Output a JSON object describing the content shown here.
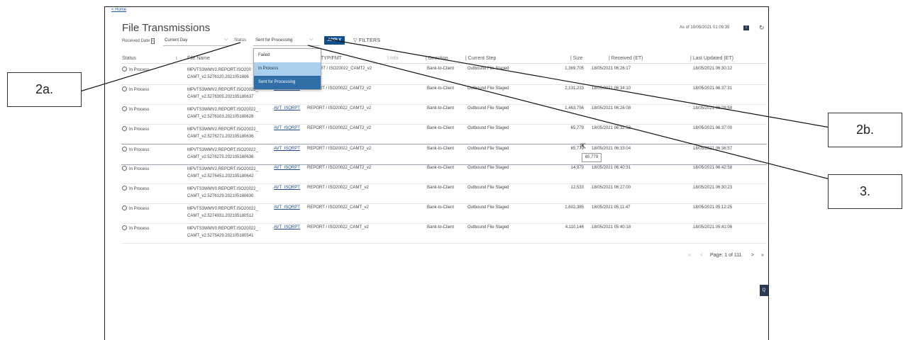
{
  "nav": {
    "home_link": "< Home"
  },
  "page": {
    "title": "File Transmissions",
    "as_of": "As of 19/05/2021 01:09:35",
    "info_icon_glyph": "i",
    "refresh_icon": "refresh-icon"
  },
  "filters": {
    "received_date_label": "Received Date",
    "received_date_info": "i",
    "received_date_value": "Current Day",
    "status_label": "Status",
    "status_value": "Sent for Processing",
    "apply_label": "APPLY",
    "filters_label": "FILTERS",
    "status_options": [
      "Failed",
      "In Process",
      "Sent for Processing"
    ]
  },
  "table": {
    "columns": [
      "Status",
      "File Name",
      "TYP/FMT",
      "Direction",
      "Current Step",
      "Size",
      "Received (ET)",
      "Last Updated (ET)"
    ],
    "hidden_column_partial": "Info",
    "rows": [
      {
        "status": "In Process",
        "file1": "MPVTS3WMV2.REPORT.ISO200",
        "file2": "CAMT_v2.5276120.2021051806",
        "link": "",
        "typ": "RT / ISO20022_CAMT2_v2",
        "direction": "Bank-to-Client",
        "step": "Outbound File Staged",
        "size": "1,369,705",
        "received": "18/05/2021 06:26:17",
        "updated": "18/05/2021 06:30:12"
      },
      {
        "status": "In Process",
        "file1": "MPVTS3WMV2.REPORT.ISO20022_",
        "file2": "CAMT_v2.5276305.202105180637",
        "link": "AVT_ISQRPT",
        "typ": "REPORT / ISO20022_CAMT2_v2",
        "direction": "Bank-to-Client",
        "step": "Outbound File Staged",
        "size": "2,131,233",
        "received": "18/05/2021 06:34:10",
        "updated": "18/05/2021 06:37:31"
      },
      {
        "status": "In Process",
        "file1": "MPVTS3WMV2.REPORT.ISO20022_",
        "file2": "CAMT_v2.5276103.202105180628",
        "link": "AVT_ISQRPT",
        "typ": "REPORT / ISO20022_CAMT2_v2",
        "direction": "Bank-to-Client",
        "step": "Outbound File Staged",
        "size": "1,463,756",
        "received": "18/05/2021 06:26:08",
        "updated": "18/05/2021 06:28:59"
      },
      {
        "status": "In Process",
        "file1": "MPVTS3WMV2.REPORT.ISO20022_",
        "file2": "CAMT_v2.5276271.202105180636",
        "link": "AVT_ISQRPT",
        "typ": "REPORT / ISO20022_CAMT2_v2",
        "direction": "Bank-to-Client",
        "step": "Outbound File Staged",
        "size": "65,779",
        "received": "18/05/2021 06:32:53",
        "updated": "18/05/2021 06:37:00"
      },
      {
        "status": "In Process",
        "file1": "MPVTS3WMV2.REPORT.ISO20022_",
        "file2": "CAMT_v2.5276275.202105180636",
        "link": "AVT_ISQRPT",
        "typ": "REPORT / ISO20022_CAMT2_v2",
        "direction": "Bank-to-Client",
        "step": "Outbound File Staged",
        "size": "65,779",
        "received": "18/05/2021 06:33:04",
        "updated": "18/05/2021 06:36:57"
      },
      {
        "status": "In Process",
        "file1": "MPVTS3WMV2.REPORT.ISO20022_",
        "file2": "CAMT_v2.5276451.202105180642",
        "link": "AVT_ISQRPT",
        "typ": "REPORT / ISO20022_CAMT2_v2",
        "direction": "Bank-to-Client",
        "step": "Outbound File Staged",
        "size": "14,979",
        "received": "18/05/2021 06:40:31",
        "updated": "18/05/2021 06:42:58"
      },
      {
        "status": "In Process",
        "file1": "MPVTS3WMV0.REPORT.ISO20022_",
        "file2": "CAMT_v2.5276129.202105180630",
        "link": "AVT_ISQRPT",
        "typ": "REPORT / ISO20022_CAMT_v2",
        "direction": "Bank-to-Client",
        "step": "Outbound File Staged",
        "size": "12,533",
        "received": "18/05/2021 06:27:00",
        "updated": "18/05/2021 06:30:23"
      },
      {
        "status": "In Process",
        "file1": "MPVTS3WMV0.REPORT.ISO20022_",
        "file2": "CAMT_v2.5274931.202105180512",
        "link": "AVT_ISQRPT",
        "typ": "REPORT / ISO20022_CAMT_v2",
        "direction": "Bank-to-Client",
        "step": "Outbound File Staged",
        "size": "1,602,385",
        "received": "18/05/2021 05:11:47",
        "updated": "18/05/2021 05:12:25"
      },
      {
        "status": "In Process",
        "file1": "MPVTS3WMV0.REPORT.ISO20022_",
        "file2": "CAMT_v2.5275429.202105180541",
        "link": "AVT_ISQRPT",
        "typ": "REPORT / ISO20022_CAMT_v2",
        "direction": "Bank-to-Client",
        "step": "Outbound File Staged",
        "size": "4,110,146",
        "received": "18/05/2021 05:40:18",
        "updated": "18/05/2021 05:41:06"
      }
    ]
  },
  "tooltip": {
    "text": "65,779"
  },
  "pagination": {
    "first": "«",
    "prev": "<",
    "label": "Page: 1 of 111",
    "next": ">",
    "last": "»"
  },
  "chat_button": {
    "label": "Q Ch"
  },
  "callouts": {
    "a": "2a.",
    "b": "2b.",
    "c": "3."
  }
}
